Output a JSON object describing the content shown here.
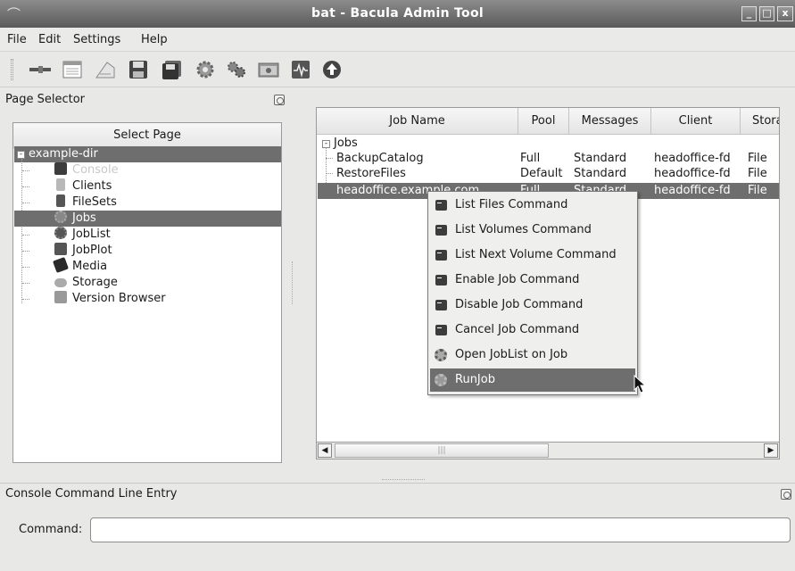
{
  "window": {
    "title": "bat - Bacula Admin Tool"
  },
  "menubar": {
    "items": [
      "File",
      "Edit",
      "Settings",
      "Help"
    ]
  },
  "toolbar": {
    "icons": [
      "connect-icon",
      "console-icon",
      "label-icon",
      "save-icon",
      "save-all-icon",
      "gear-icon",
      "status-icon",
      "browse-icon",
      "jobplot-icon",
      "up-icon"
    ]
  },
  "page_selector": {
    "title": "Page Selector",
    "header": "Select Page",
    "root": "example-dir",
    "items": [
      {
        "label": "Console",
        "icon": "console-icon",
        "state": "disabled"
      },
      {
        "label": "Clients",
        "icon": "client-icon",
        "state": "normal"
      },
      {
        "label": "FileSets",
        "icon": "fileset-icon",
        "state": "normal"
      },
      {
        "label": "Jobs",
        "icon": "gear-icon",
        "state": "selected"
      },
      {
        "label": "JobList",
        "icon": "gear-icon",
        "state": "normal"
      },
      {
        "label": "JobPlot",
        "icon": "jobplot-icon",
        "state": "normal"
      },
      {
        "label": "Media",
        "icon": "media-icon",
        "state": "normal"
      },
      {
        "label": "Storage",
        "icon": "storage-icon",
        "state": "normal"
      },
      {
        "label": "Version Browser",
        "icon": "browse-icon",
        "state": "normal"
      }
    ]
  },
  "jobs_table": {
    "columns": [
      "Job Name",
      "Pool",
      "Messages",
      "Client",
      "Stora"
    ],
    "group": "Jobs",
    "rows": [
      {
        "name": "BackupCatalog",
        "pool": "Full",
        "messages": "Standard",
        "client": "headoffice-fd",
        "storage": "File"
      },
      {
        "name": "RestoreFiles",
        "pool": "Default",
        "messages": "Standard",
        "client": "headoffice-fd",
        "storage": "File"
      },
      {
        "name": "headoffice.example.com",
        "pool": "Full",
        "messages": "Standard",
        "client": "headoffice-fd",
        "storage": "File"
      }
    ],
    "selected_row": 2
  },
  "context_menu": {
    "items": [
      {
        "label": "List Files Command",
        "icon": "console-icon"
      },
      {
        "label": "List Volumes Command",
        "icon": "console-icon"
      },
      {
        "label": "List Next Volume Command",
        "icon": "console-icon"
      },
      {
        "label": "Enable Job Command",
        "icon": "console-icon"
      },
      {
        "label": "Disable Job Command",
        "icon": "console-icon"
      },
      {
        "label": "Cancel Job Command",
        "icon": "console-icon"
      },
      {
        "label": "Open JobList on Job",
        "icon": "gear-icon"
      },
      {
        "label": "RunJob",
        "icon": "gear-icon"
      }
    ],
    "highlighted": "RunJob"
  },
  "console": {
    "title": "Console Command Line Entry",
    "command_label": "Command:",
    "command_value": ""
  },
  "colors": {
    "selection": "#6e6e6e",
    "titlebar": "#6a6a6a"
  }
}
